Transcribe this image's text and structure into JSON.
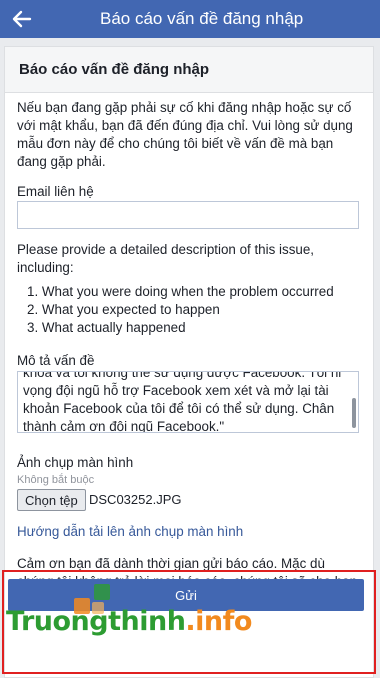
{
  "header": {
    "back_icon": "arrow-left-icon",
    "title": "Báo cáo vấn đề đăng nhập"
  },
  "card": {
    "title": "Báo cáo vấn đề đăng nhập",
    "intro_text": "Nếu bạn đang gặp phải sự cố khi đăng nhập hoặc sự cố với mật khẩu, bạn đã đến đúng địa chỉ. Vui lòng sử dụng mẫu đơn này để cho chúng tôi biết về vấn đề mà bạn đang gặp phải."
  },
  "email": {
    "label": "Email liên hệ",
    "value": ""
  },
  "description": {
    "prompt": "Please provide a detailed description of this issue, including:",
    "steps": [
      "1. What you were doing when the problem occurred",
      "2. What you expected to happen",
      "3. What actually happened"
    ]
  },
  "problem": {
    "label": "Mô tả vấn đề",
    "value_lines": [
      "khóa và tôi không thể sử dụng được Facebook. Tôi hi",
      "vọng đội ngũ hỗ trợ Facebook xem xét và mở lại tài",
      "khoản Facebook của tôi để tôi có thể sử dụng. Chân",
      "thành cảm ơn đội ngũ Facebook.\""
    ]
  },
  "screenshot": {
    "label": "Ảnh chụp màn hình",
    "optional_note": "Không bắt buộc",
    "choose_file_label": "Chọn tệp",
    "file_name": "DSC03252.JPG",
    "guide_link": "Hướng dẫn tải lên ảnh chụp màn hình"
  },
  "thanks_text": "Cảm ơn bạn đã dành thời gian gửi báo cáo. Mặc dù chúng tôi không trả lời mọi báo cáo, chúng tôi sẽ cho bạn biết nếu chúng tôi cần thêm chi tiết.",
  "submit_label": "Gửi",
  "watermark": {
    "part1": "Truongthinh",
    "part2": ".info"
  },
  "colors": {
    "brand": "#4267b2",
    "link": "#365899",
    "highlight": "#e02020"
  }
}
